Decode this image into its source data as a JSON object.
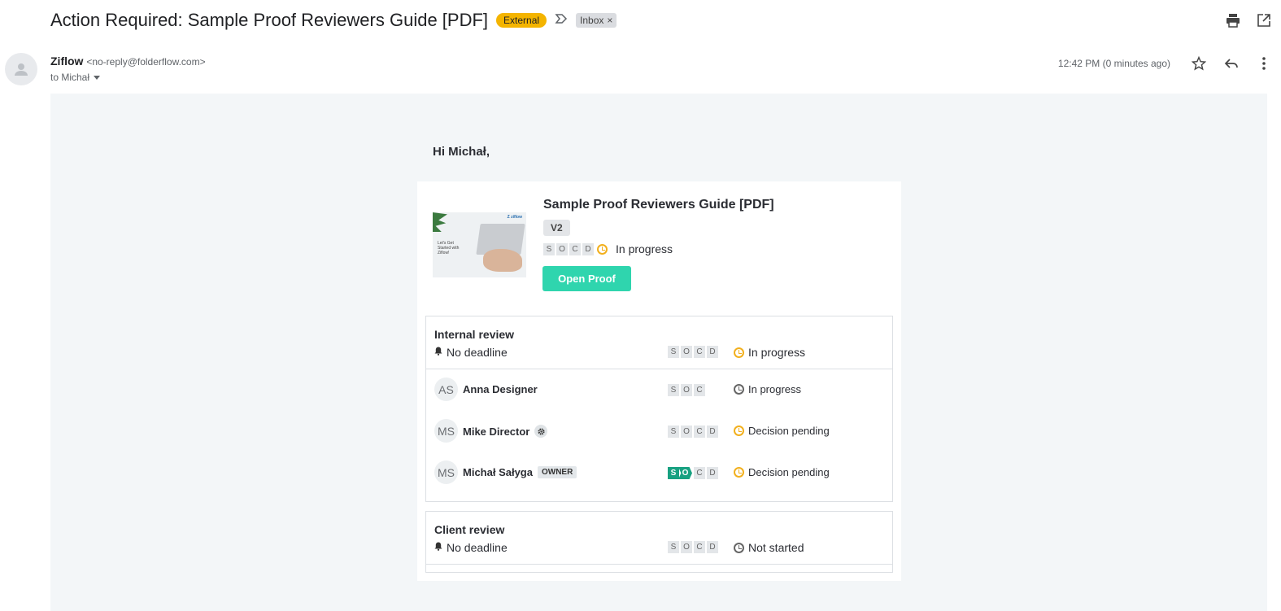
{
  "email": {
    "subject": "Action Required: Sample Proof Reviewers Guide [PDF]",
    "label_external": "External",
    "label_inbox": "Inbox",
    "label_inbox_close": "×",
    "sender_name": "Ziflow",
    "sender_email": "<no-reply@folderflow.com>",
    "to_line": "to Michał",
    "timestamp": "12:42 PM (0 minutes ago)"
  },
  "body": {
    "greeting": "Hi Michał,",
    "proof": {
      "title": "Sample Proof Reviewers Guide [PDF]",
      "version": "V2",
      "status": "In progress",
      "open_button": "Open Proof",
      "thumb_logo": "Z ziflow",
      "thumb_text": "Let's Get Started with Ziflow!"
    },
    "step_letters": [
      "S",
      "O",
      "C",
      "D"
    ],
    "internal_review": {
      "title": "Internal review",
      "deadline": "No deadline",
      "status": "In progress",
      "members": [
        {
          "initials": "AS",
          "name": "Anna Designer",
          "status": "In progress"
        },
        {
          "initials": "MS",
          "name": "Mike Director",
          "status": "Decision pending"
        },
        {
          "initials": "MS",
          "name": "Michał Sałyga",
          "badge": "OWNER",
          "status": "Decision pending"
        }
      ]
    },
    "client_review": {
      "title": "Client review",
      "deadline": "No deadline",
      "status": "Not started"
    }
  },
  "icons": [
    "print-icon",
    "open-in-new-icon",
    "star-icon",
    "reply-icon",
    "more-vert-icon",
    "bell-icon",
    "clock-icon",
    "gear-icon",
    "label-icon",
    "dropdown-icon",
    "avatar-icon"
  ],
  "colors": {
    "accent": "#2fd5ae",
    "external_badge": "#f4b400",
    "step_done": "#17a181",
    "clock": "#f2b01e"
  }
}
